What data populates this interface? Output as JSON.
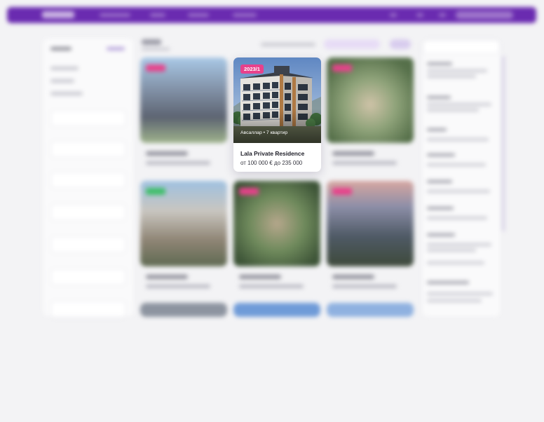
{
  "focused_card": {
    "badge": "2023/1",
    "location": "Авсаллар • 7 квартир",
    "title": "Lala Private Residence",
    "price": "от 100 000 € до 235 000"
  },
  "colors": {
    "brand": "#6a2bb0",
    "badge": "#e8418b",
    "badge_green": "#3fbf6a"
  }
}
